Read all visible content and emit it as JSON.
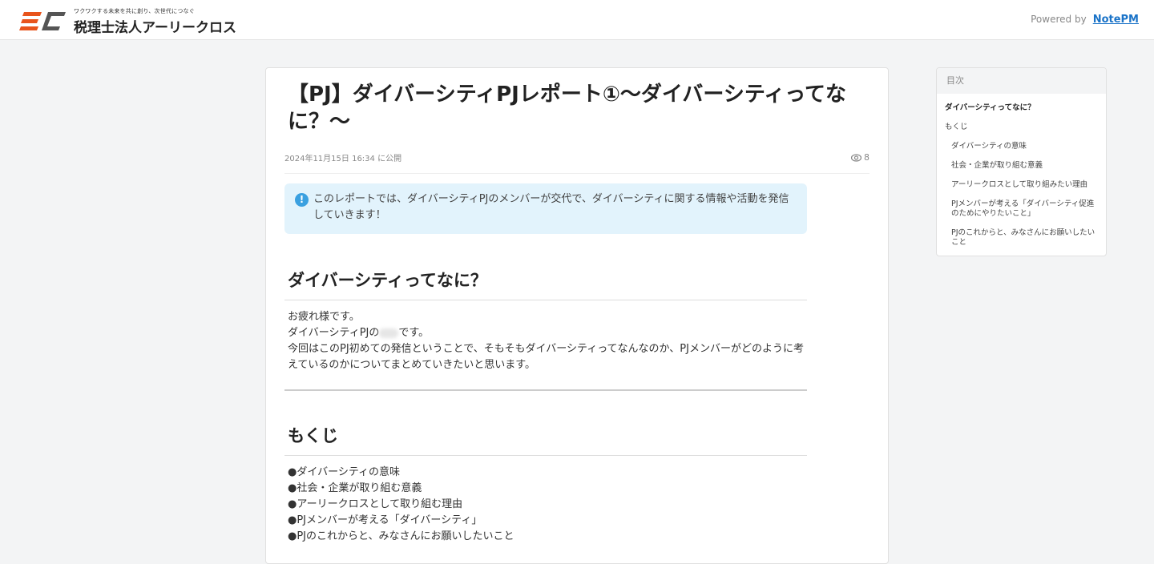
{
  "header": {
    "tagline": "ワクワクする未来を共に創り、次世代につなぐ",
    "company": "税理士法人アーリークロス",
    "powered_by": "Powered by",
    "brand": "NotePM",
    "logo_text": "EC"
  },
  "article": {
    "title": "【PJ】ダイバーシティPJレポート①～ダイバーシティってなに？～",
    "published": "2024年11月15日 16:34 に公開",
    "views": "8",
    "info": "このレポートでは、ダイバーシティPJのメンバーが交代で、ダイバーシティに関する情報や活動を発信していきます！",
    "h2_1": "ダイバーシティってなに？",
    "p1": "お疲れ様です。",
    "p2a": "ダイバーシティPJの",
    "p2b": "です。",
    "p3": "今回はこのPJ初めての発信ということで、そもそもダイバーシティってなんなのか、PJメンバーがどのように考えているのかについてまとめていきたいと思います。",
    "h2_2": "もくじ",
    "list": [
      "●ダイバーシティの意味",
      "●社会・企業が取り組む意義",
      "●アーリークロスとして取り組む理由",
      "●PJメンバーが考える「ダイバーシティ」",
      "●PJのこれからと、みなさんにお願いしたいこと"
    ]
  },
  "toc": {
    "title": "目次",
    "items": [
      "ダイバーシティってなに？",
      "もくじ",
      "ダイバーシティの意味",
      "社会・企業が取り組む意義",
      "アーリークロスとして取り組みたい理由",
      "PJメンバーが考える「ダイバーシティ促進のためにやりたいこと」",
      "PJのこれからと、みなさんにお願いしたいこと"
    ]
  }
}
